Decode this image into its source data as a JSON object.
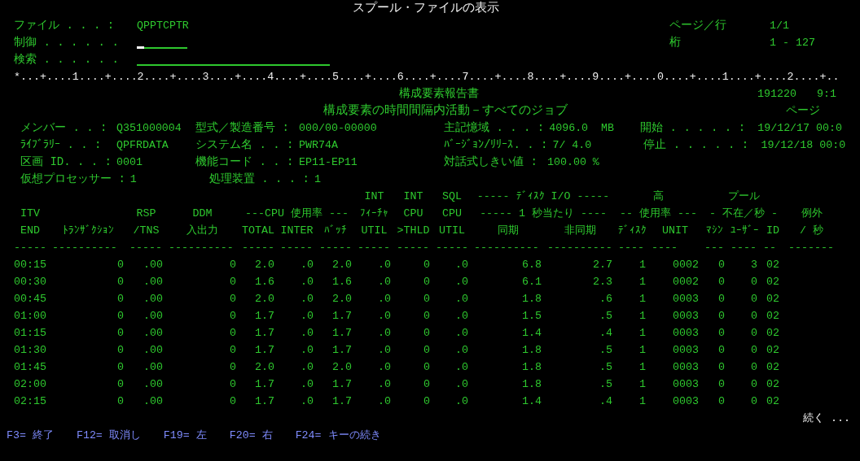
{
  "title": "スプール・ファイルの表示",
  "fields": [
    {
      "label": "ファイル . . . :",
      "kind": "value",
      "value": "QPPTCPTR"
    },
    {
      "label": "制御 . . . . . .",
      "kind": "input",
      "cursor": true
    },
    {
      "label": "検索 . . . . . .",
      "kind": "input",
      "cursor": false
    }
  ],
  "position": [
    {
      "label": "ページ／行",
      "value": "1/1"
    },
    {
      "label": "桁",
      "value": "1 - 127"
    }
  ],
  "ruler": "*...+....1....+....2....+....3....+....4....+....5....+....6....+....7....+....8....+....9....+....0....+....1....+....2....+..",
  "report": {
    "title": "構成要素報告書",
    "date": "191220",
    "time": "9:1",
    "subtitle": "構成要素の時間間隔内活動－すべてのジョブ",
    "page_label": "ページ",
    "info_rows": [
      [
        {
          "label": "メンバー . . :",
          "value": "Q351000004"
        },
        {
          "label": "型式／製造番号 :",
          "value": "000/00-00000"
        },
        {
          "label": "主記憶域 . . . :",
          "value": "4096.0  MB"
        },
        {
          "label": "開始 . . . . . :",
          "value": "19/12/17 00:0"
        }
      ],
      [
        {
          "label": "ﾗｲﾌﾞﾗﾘｰ . . :",
          "value": "QPFRDATA"
        },
        {
          "label": "システム名 . . :",
          "value": "PWR74A"
        },
        {
          "label": "ﾊﾞｰｼﾞｮﾝ/ﾘﾘｰｽ. . :",
          "value": "7/ 4.0"
        },
        {
          "label": "停止 . . . . . :",
          "value": "19/12/18 00:0"
        }
      ],
      [
        {
          "label": "区画 ID. . . :",
          "value": "0001"
        },
        {
          "label": "機能コード . . :",
          "value": "EP11-EP11"
        },
        {
          "label": "対話式しきい値 :",
          "value": "100.00 %"
        }
      ],
      [
        {
          "label": "仮想プロセッサー :",
          "value": "1"
        },
        {
          "label": "処理装置 . . . :",
          "value": "1"
        }
      ]
    ]
  },
  "table": {
    "header_rows": [
      [
        {
          "text": "INT"
        },
        {
          "text": "INT"
        },
        {
          "text": "SQL"
        },
        {
          "text": "----- ﾃﾞｨｽｸ I/O -----"
        },
        {
          "text": "高"
        },
        {
          "text": "プール"
        }
      ],
      [
        {
          "text": "ITV"
        },
        {
          "text": "RSP"
        },
        {
          "text": "DDM"
        },
        {
          "text": "---CPU 使用率 ---"
        },
        {
          "text": "ﾌｨｰﾁｬ"
        },
        {
          "text": "CPU"
        },
        {
          "text": "CPU"
        },
        {
          "text": "----- 1 秒当たり ----"
        },
        {
          "text": "-- 使用率 ---"
        },
        {
          "text": "- 不在／秒 -"
        },
        {
          "text": "例外"
        }
      ],
      [
        {
          "text": "END"
        },
        {
          "text": "ﾄﾗﾝｻﾞｸｼｮﾝ"
        },
        {
          "text": "/TNS"
        },
        {
          "text": "入出力"
        },
        {
          "text": "TOTAL"
        },
        {
          "text": "INTER"
        },
        {
          "text": "ﾊﾞｯﾁ"
        },
        {
          "text": "UTIL"
        },
        {
          "text": ">THLD"
        },
        {
          "text": "UTIL"
        },
        {
          "text": "同期"
        },
        {
          "text": "非同期"
        },
        {
          "text": "ﾃﾞｨｽｸ"
        },
        {
          "text": "UNIT"
        },
        {
          "text": "ﾏｼﾝ"
        },
        {
          "text": "ﾕｰｻﾞｰ"
        },
        {
          "text": "ID"
        },
        {
          "text": "/ 秒"
        }
      ],
      [
        {
          "text": "-----"
        },
        {
          "text": "----------"
        },
        {
          "text": "-----"
        },
        {
          "text": "----------"
        },
        {
          "text": "-----"
        },
        {
          "text": "-----"
        },
        {
          "text": "-----"
        },
        {
          "text": "-----"
        },
        {
          "text": "-----"
        },
        {
          "text": "-----"
        },
        {
          "text": "----------"
        },
        {
          "text": "----------"
        },
        {
          "text": "----"
        },
        {
          "text": "----"
        },
        {
          "text": "---"
        },
        {
          "text": "----"
        },
        {
          "text": "--"
        },
        {
          "text": "-------"
        }
      ]
    ],
    "rows": [
      [
        "00:15",
        "0",
        ".00",
        "0",
        "2.0",
        ".0",
        "2.0",
        ".0",
        "0",
        ".0",
        "6.8",
        "2.7",
        "1",
        "0002",
        "0",
        "3",
        "02"
      ],
      [
        "00:30",
        "0",
        ".00",
        "0",
        "1.6",
        ".0",
        "1.6",
        ".0",
        "0",
        ".0",
        "6.1",
        "2.3",
        "1",
        "0002",
        "0",
        "0",
        "02"
      ],
      [
        "00:45",
        "0",
        ".00",
        "0",
        "2.0",
        ".0",
        "2.0",
        ".0",
        "0",
        ".0",
        "1.8",
        ".6",
        "1",
        "0003",
        "0",
        "0",
        "02"
      ],
      [
        "01:00",
        "0",
        ".00",
        "0",
        "1.7",
        ".0",
        "1.7",
        ".0",
        "0",
        ".0",
        "1.5",
        ".5",
        "1",
        "0003",
        "0",
        "0",
        "02"
      ],
      [
        "01:15",
        "0",
        ".00",
        "0",
        "1.7",
        ".0",
        "1.7",
        ".0",
        "0",
        ".0",
        "1.4",
        ".4",
        "1",
        "0003",
        "0",
        "0",
        "02"
      ],
      [
        "01:30",
        "0",
        ".00",
        "0",
        "1.7",
        ".0",
        "1.7",
        ".0",
        "0",
        ".0",
        "1.8",
        ".5",
        "1",
        "0003",
        "0",
        "0",
        "02"
      ],
      [
        "01:45",
        "0",
        ".00",
        "0",
        "2.0",
        ".0",
        "2.0",
        ".0",
        "0",
        ".0",
        "1.8",
        ".5",
        "1",
        "0003",
        "0",
        "0",
        "02"
      ],
      [
        "02:00",
        "0",
        ".00",
        "0",
        "1.7",
        ".0",
        "1.7",
        ".0",
        "0",
        ".0",
        "1.8",
        ".5",
        "1",
        "0003",
        "0",
        "0",
        "02"
      ],
      [
        "02:15",
        "0",
        ".00",
        "0",
        "1.7",
        ".0",
        "1.7",
        ".0",
        "0",
        ".0",
        "1.4",
        ".4",
        "1",
        "0003",
        "0",
        "0",
        "02"
      ]
    ]
  },
  "more": "続く ...",
  "function_keys": [
    "F3= 終了",
    "F12= 取消し",
    "F19= 左",
    "F20= 右",
    "F24= キーの続き"
  ]
}
